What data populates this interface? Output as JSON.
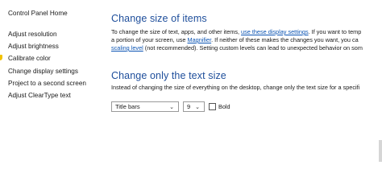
{
  "sidebar": {
    "home_link": "Control Panel Home",
    "items": [
      "Adjust resolution",
      "Adjust brightness",
      "Calibrate color",
      "Change display settings",
      "Project to a second screen",
      "Adjust ClearType text"
    ]
  },
  "section_items": {
    "heading": "Change size of items",
    "line1_prefix": "To change the size of text, apps, and other items,",
    "line1_link": "use these display settings",
    "line1_suffix": ". If you want to temp",
    "line2_prefix": "a portion of your screen, use",
    "line2_link": "Magnifier",
    "line2_suffix": ". If neither of these makes the changes you want, you ca",
    "line3_link": "scaling level",
    "line3_suffix": "(not recommended). Setting custom levels can lead to unexpected behavior on som"
  },
  "section_text": {
    "heading": "Change only the text size",
    "description": "Instead of changing the size of everything on the desktop, change only the text size for a specifi",
    "element_select_value": "Title bars",
    "size_select_value": "9",
    "bold_label": "Bold"
  },
  "icons": {
    "dropdown": "chevron-down-icon",
    "admin": "shield-icon"
  }
}
